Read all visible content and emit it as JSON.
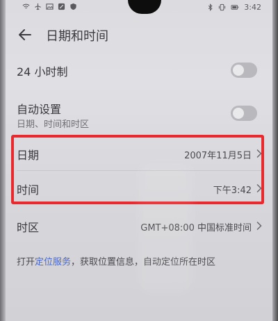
{
  "status_bar": {
    "time": "3:42",
    "icons": [
      "wifi-icon",
      "airplane-icon",
      "image-icon",
      "app-icon",
      "shield-icon"
    ],
    "right_icons": [
      "bluetooth-icon",
      "vibrate-icon",
      "battery-icon"
    ]
  },
  "header": {
    "title": "日期和时间",
    "back_icon": "back-arrow-icon"
  },
  "settings": {
    "hour24": {
      "label": "24 小时制",
      "on": false
    },
    "auto": {
      "label": "自动设置",
      "subtitle": "日期、时间和时区",
      "on": false
    },
    "date": {
      "label": "日期",
      "value": "2007年11月5日"
    },
    "time": {
      "label": "时间",
      "value": "下午3:42"
    },
    "timezone": {
      "label": "时区",
      "value": "GMT+08:00 中国标准时间"
    }
  },
  "note": {
    "prefix": "打开",
    "link": "定位服务",
    "suffix": "，获取位置信息，自动定位所在时区"
  },
  "colors": {
    "highlight": "#e8292d",
    "link": "#4b67c9"
  }
}
